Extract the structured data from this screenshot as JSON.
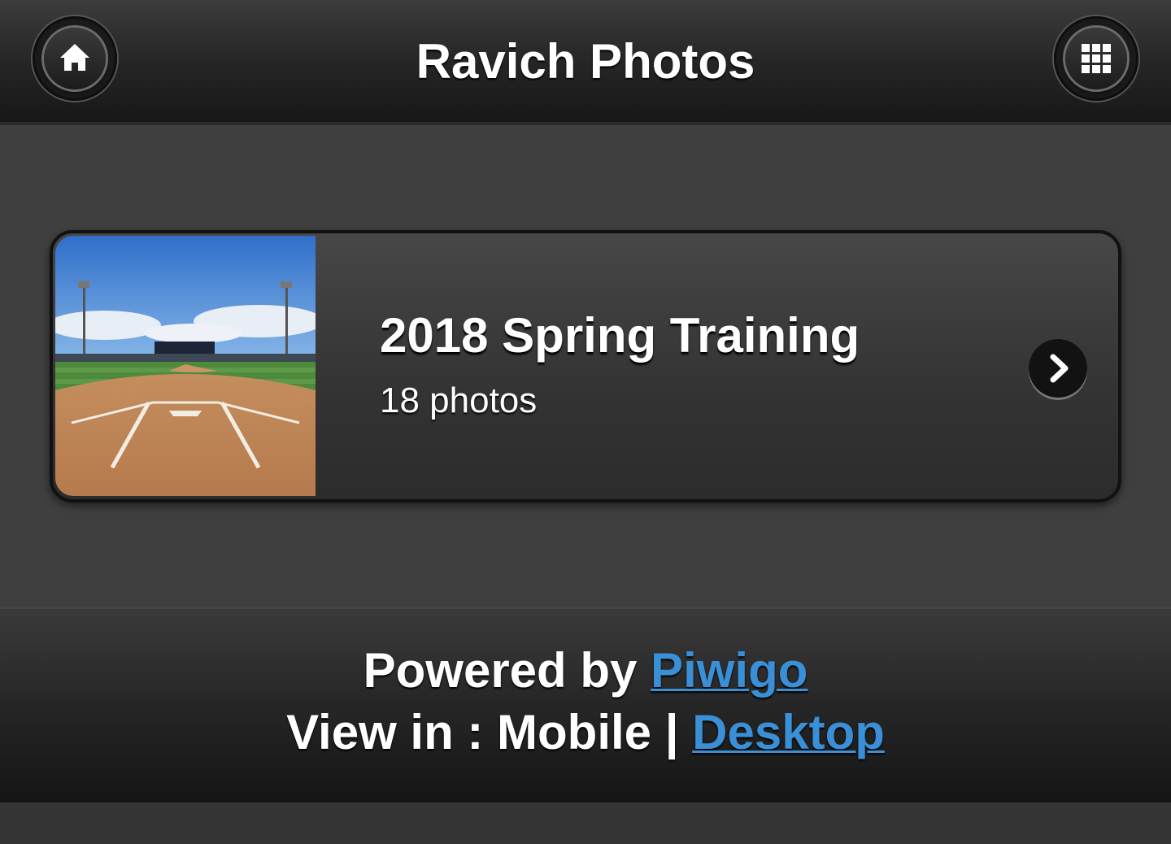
{
  "header": {
    "title": "Ravich Photos",
    "home_icon": "home-icon",
    "menu_icon": "grid-menu-icon"
  },
  "album": {
    "title": "2018 Spring Training",
    "count": "18 photos",
    "chevron_icon": "chevron-right-icon"
  },
  "footer": {
    "powered_prefix": "Powered by ",
    "powered_link": "Piwigo",
    "view_prefix": "View in : Mobile | ",
    "view_link": "Desktop",
    "link_color": "#3a8fd6"
  }
}
